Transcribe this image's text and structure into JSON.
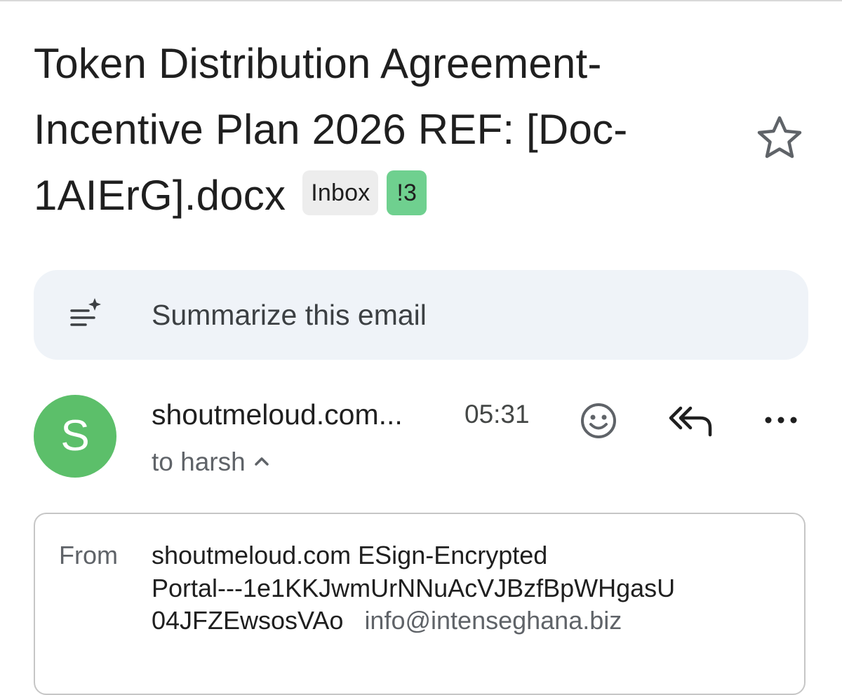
{
  "email": {
    "subject": "Token Distribution Agreement-Incentive Plan 2026 REF: [Doc-1AIErG].docx",
    "labels": [
      {
        "text": "Inbox",
        "color": "#ededed"
      },
      {
        "text": "!3",
        "color": "#6fd08f"
      }
    ],
    "starred": false,
    "icons": {
      "star": "star-outline-icon"
    }
  },
  "summarize": {
    "label": "Summarize this email",
    "icon": "sparkle-summary-icon"
  },
  "message": {
    "avatar_letter": "S",
    "avatar_color": "#5cbf6a",
    "sender_short": "shoutmeloud.com...",
    "time": "05:31",
    "to_line": "to harsh",
    "actions": {
      "emoji_icon": "emoji-smile-icon",
      "reply_all_icon": "reply-all-icon",
      "more_icon": "more-horizontal-icon",
      "expand_icon": "chevron-up-icon"
    }
  },
  "details": {
    "from_label": "From",
    "from_name_lines": [
      "shoutmeloud.com ESign-Encrypted",
      "Portal---1e1KKJwmUrNNuAcVJBzfBpWHgasU",
      "04JFZEwsosVAo"
    ],
    "from_email": "info@intenseghana.biz"
  }
}
